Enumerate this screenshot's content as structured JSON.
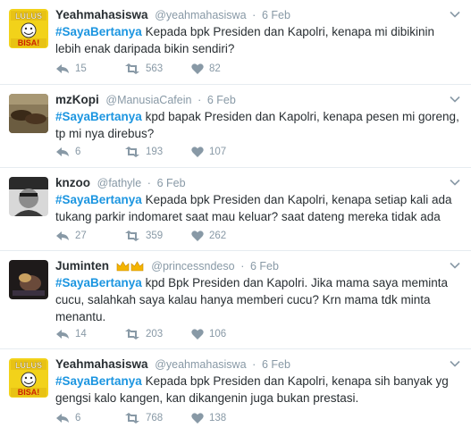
{
  "tweets": [
    {
      "name": "Yeahmahasiswa",
      "handle": "@yeahmahasiswa",
      "time": "6 Feb",
      "hashtag": "#SayaBertanya",
      "text": " Kepada bpk Presiden dan Kapolri, kenapa mi dibikinin lebih enak daripada bikin sendiri?",
      "replies": "15",
      "retweets": "563",
      "likes": "82",
      "avatar": "lulus-bisa",
      "avatar_text": [
        "LULUS",
        "BISA!"
      ]
    },
    {
      "name": "mzKopi",
      "handle": "@ManusiaCafein",
      "time": "6 Feb",
      "hashtag": "#SayaBertanya",
      "text": " kpd bapak Presiden dan Kapolri, kenapa pesen mi goreng, tp mi nya direbus?",
      "replies": "6",
      "retweets": "193",
      "likes": "107",
      "avatar": "shoes-photo"
    },
    {
      "name": "knzoo",
      "handle": "@fathyle",
      "time": "6 Feb",
      "hashtag": "#SayaBertanya",
      "text": " Kepada bpk Presiden dan Kapolri, kenapa setiap kali ada tukang parkir indomaret saat mau keluar? saat dateng mereka tidak ada",
      "replies": "27",
      "retweets": "359",
      "likes": "262",
      "avatar": "portrait-bw"
    },
    {
      "name": "Juminten",
      "handle": "@princessndeso",
      "time": "6 Feb",
      "hashtag": "#SayaBertanya",
      "text": " kpd Bpk Presiden dan Kapolri. Jika mama saya meminta cucu, salahkah saya kalau hanya memberi cucu? Krn mama tdk minta menantu.",
      "replies": "14",
      "retweets": "203",
      "likes": "106",
      "avatar": "dark-photo",
      "badge_icon": "crown-emoji"
    },
    {
      "name": "Yeahmahasiswa",
      "handle": "@yeahmahasiswa",
      "time": "6 Feb",
      "hashtag": "#SayaBertanya",
      "text": " Kepada bpk Presiden dan Kapolri, kenapa sih banyak yg gengsi kalo kangen, kan dikangenin juga bukan prestasi.",
      "replies": "6",
      "retweets": "768",
      "likes": "138",
      "avatar": "lulus-bisa",
      "avatar_text": [
        "LULUS",
        "BISA!"
      ]
    }
  ],
  "colors": {
    "hashtag": "#1b95e0",
    "meta": "#8899a6",
    "text": "#292f33",
    "divider": "#e6ecf0"
  }
}
